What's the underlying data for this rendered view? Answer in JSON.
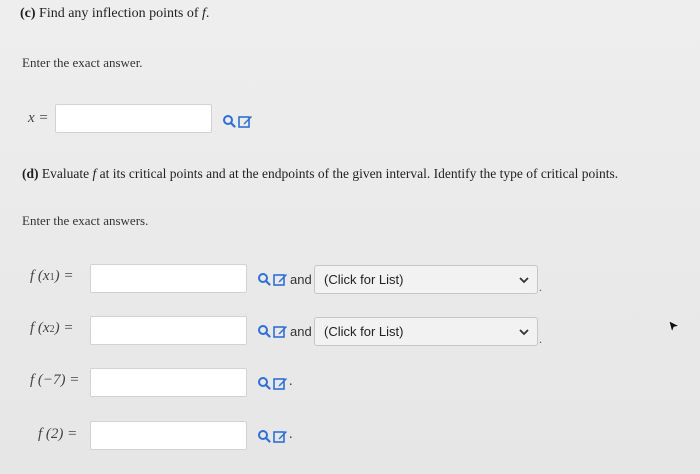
{
  "part_c": {
    "label": "(c)",
    "text": "Find any inflection points of",
    "func": "f",
    "end": ".",
    "instruction": "Enter the exact answer.",
    "var_label": "x =",
    "answer_value": ""
  },
  "part_d": {
    "label": "(d)",
    "text_before": "Evaluate",
    "func": "f",
    "text_after": "at its critical points and at the endpoints of the given interval. Identify the type of critical points.",
    "instruction": "Enter the exact answers.",
    "rows": [
      {
        "label_f": "f",
        "label_arg": "(x",
        "label_sub": "1",
        "label_close": ") =",
        "value": "",
        "and": "and",
        "select": "(Click for List)"
      },
      {
        "label_f": "f",
        "label_arg": "(x",
        "label_sub": "2",
        "label_close": ") =",
        "value": "",
        "and": "and",
        "select": "(Click for List)"
      },
      {
        "label": "f (−7) =",
        "value": "",
        "end": "."
      },
      {
        "label": "f (2) =",
        "value": "",
        "end": "."
      }
    ]
  },
  "colors": {
    "icon_blue": "#2f6fd6",
    "page_background": "#e9e9e9"
  },
  "icons": [
    "search-icon",
    "edit-icon",
    "chevron-down-icon",
    "mouse-cursor-icon"
  ]
}
